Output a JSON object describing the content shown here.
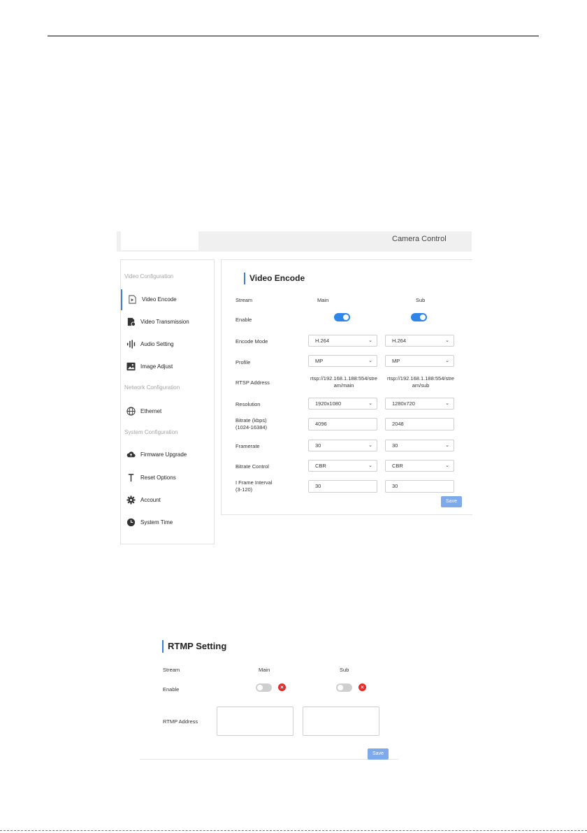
{
  "app": {
    "title": "Camera Control"
  },
  "sidebar": {
    "sections": [
      "Video Configuration",
      "Network Configuration",
      "System Configuration"
    ],
    "items": [
      {
        "label": "Video Encode",
        "icon": "video-encode-icon"
      },
      {
        "label": "Video Transmission",
        "icon": "video-transmission-icon"
      },
      {
        "label": "Audio Setting",
        "icon": "audio-icon"
      },
      {
        "label": "Image Adjust",
        "icon": "image-icon"
      },
      {
        "label": "Ethernet",
        "icon": "globe-icon"
      },
      {
        "label": "Firmware Upgrade",
        "icon": "cloud-upload-icon"
      },
      {
        "label": "Reset Options",
        "icon": "reset-icon"
      },
      {
        "label": "Account",
        "icon": "gear-icon"
      },
      {
        "label": "System Time",
        "icon": "clock-icon"
      }
    ],
    "active": "Video Encode"
  },
  "video_encode": {
    "title": "Video Encode",
    "labels": {
      "stream": "Stream",
      "enable": "Enable",
      "encode_mode": "Encode Mode",
      "profile": "Profile",
      "rtsp_address": "RTSP Address",
      "resolution": "Resolution",
      "bitrate_l1": "Bitrate (kbps)",
      "bitrate_l2": "(1024-16384)",
      "framerate": "Framerate",
      "bitrate_control": "Bitrate Control",
      "iframe_l1": "I Frame Interval",
      "iframe_l2": "(3-120)"
    },
    "main": {
      "header": "Main",
      "enabled": true,
      "encode_mode": "H.264",
      "profile": "MP",
      "rtsp_l1": "rtsp://192.168.1.188:554/stre",
      "rtsp_l2": "am/main",
      "resolution": "1920x1080",
      "bitrate": "4096",
      "framerate": "30",
      "bitrate_control": "CBR",
      "iframe_interval": "30"
    },
    "sub": {
      "header": "Sub",
      "enabled": true,
      "encode_mode": "H.264",
      "profile": "MP",
      "rtsp_l1": "rtsp://192.168.1.188:554/stre",
      "rtsp_l2": "am/sub",
      "resolution": "1280x720",
      "bitrate": "2048",
      "framerate": "30",
      "bitrate_control": "CBR",
      "iframe_interval": "30"
    },
    "save_label": "Save"
  },
  "rtmp": {
    "title": "RTMP Setting",
    "labels": {
      "stream": "Stream",
      "enable": "Enable",
      "address": "RTMP Address"
    },
    "main": {
      "header": "Main",
      "enabled": false,
      "address": ""
    },
    "sub": {
      "header": "Sub",
      "enabled": false,
      "address": ""
    },
    "save_label": "Save"
  },
  "colors": {
    "accent": "#2f86e8",
    "button": "#7ea9ea",
    "error": "#e32b2b"
  }
}
